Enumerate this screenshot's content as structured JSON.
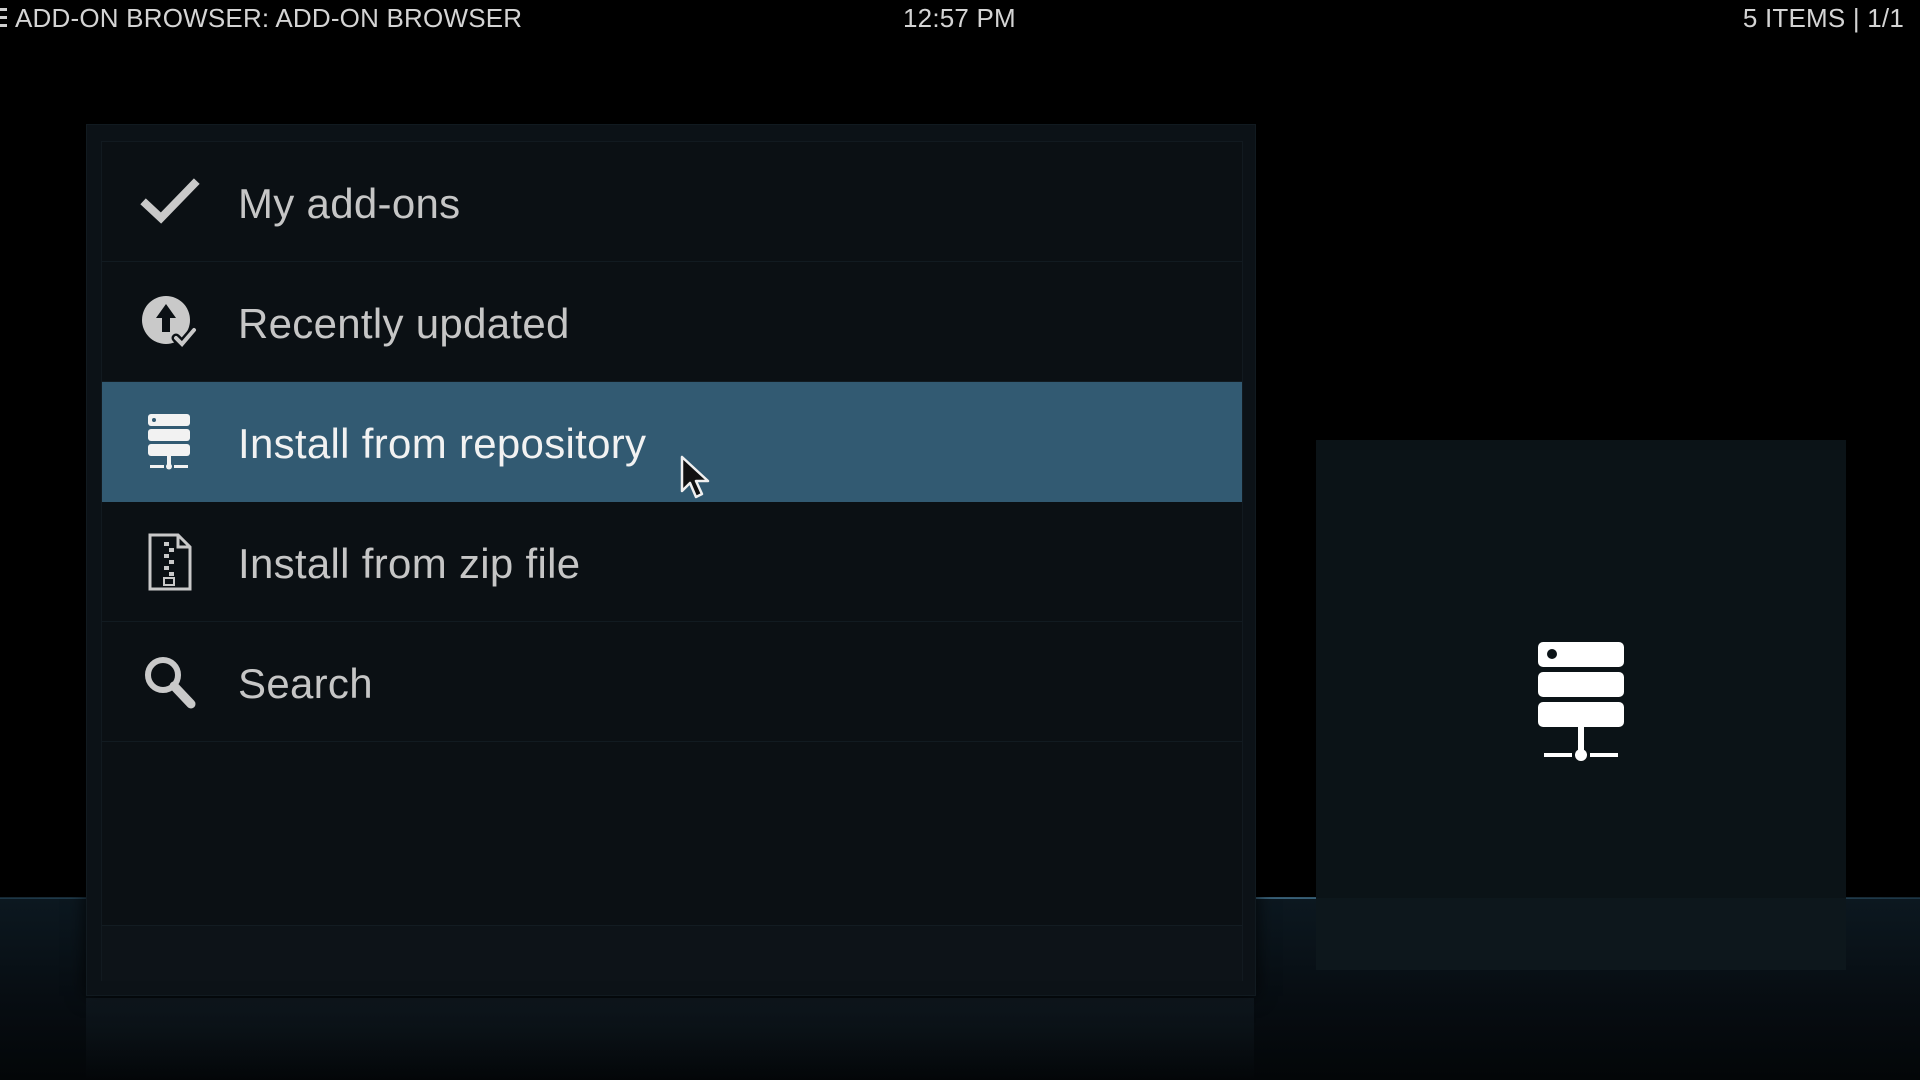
{
  "topbar": {
    "title": "ADD-ON BROWSER: ADD-ON BROWSER",
    "clock": "12:57 PM",
    "item_count": "5 ITEMS | 1/1"
  },
  "menu": {
    "items": [
      {
        "label": "My add-ons",
        "icon": "checkmark-icon",
        "focused": false
      },
      {
        "label": "Recently updated",
        "icon": "update-icon",
        "focused": false
      },
      {
        "label": "Install from repository",
        "icon": "server-icon",
        "focused": true
      },
      {
        "label": "Install from zip file",
        "icon": "zip-file-icon",
        "focused": false
      },
      {
        "label": "Search",
        "icon": "search-icon",
        "focused": false
      }
    ]
  },
  "preview": {
    "icon": "server-icon"
  },
  "colors": {
    "background": "#000000",
    "panel": "#0b1014",
    "focused_row": "#325a72",
    "text": "#c6c6c6",
    "text_focused": "#f2f2f2"
  }
}
